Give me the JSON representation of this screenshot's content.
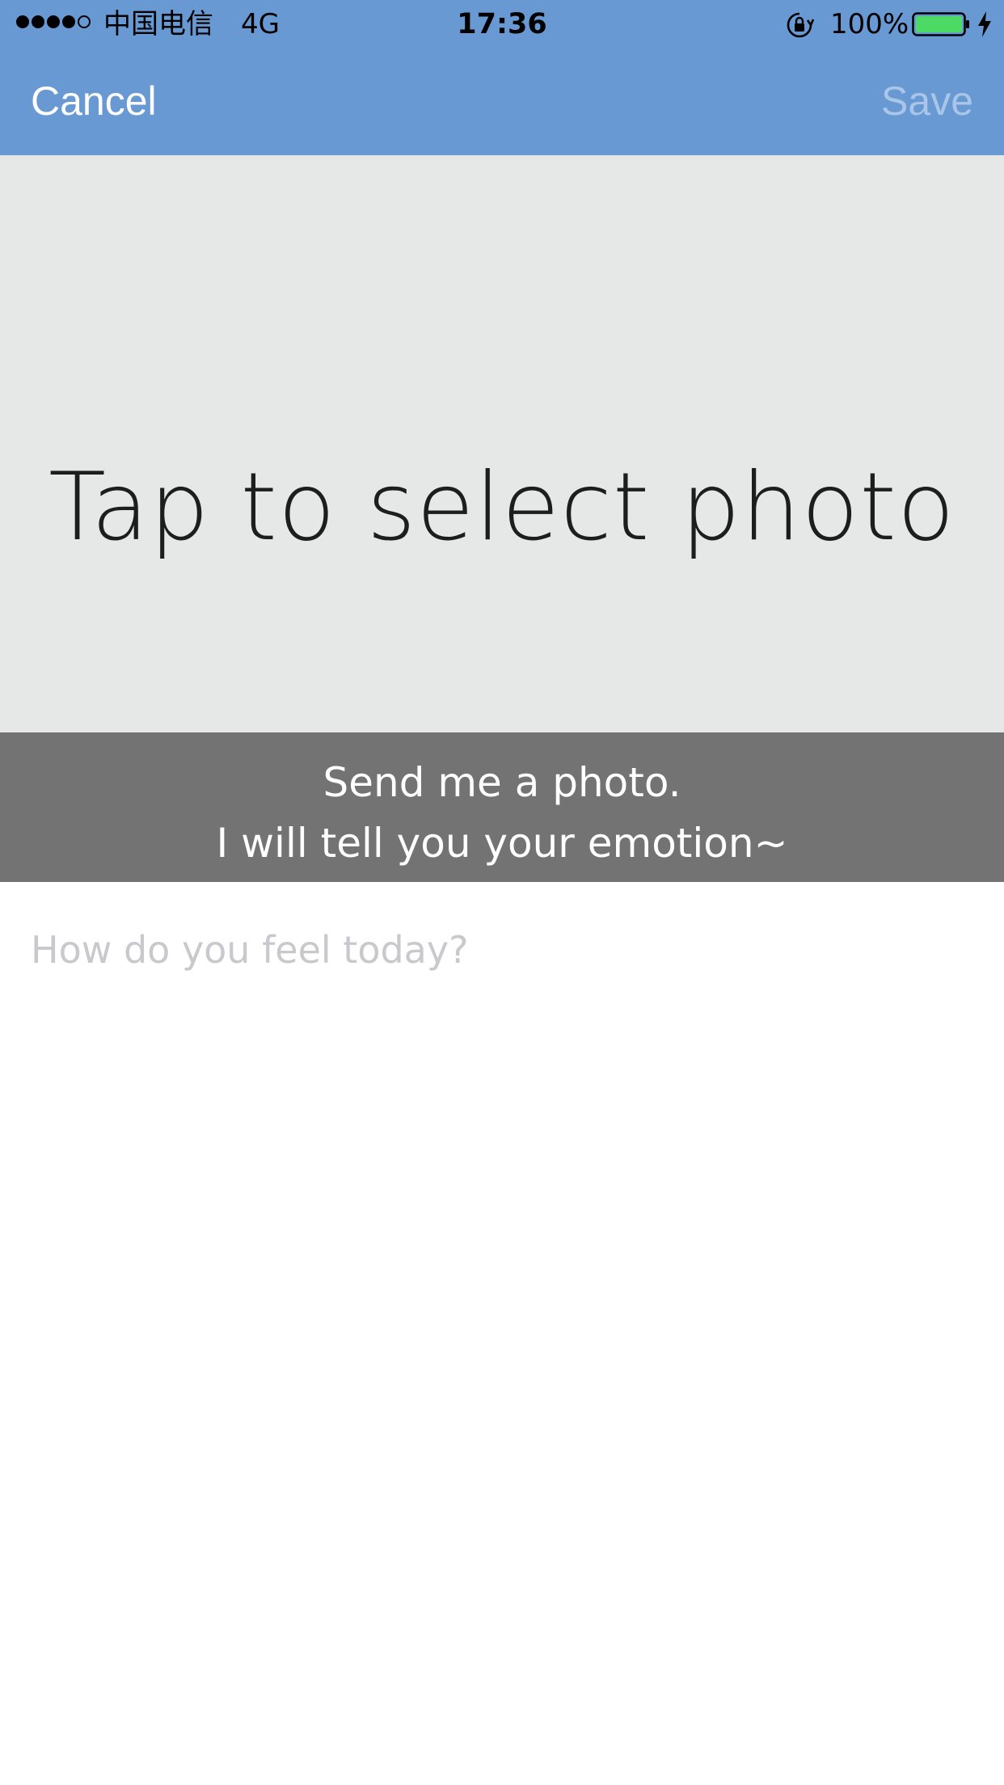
{
  "status_bar": {
    "carrier": "中国电信",
    "network": "4G",
    "time": "17:36",
    "battery_percent": "100%",
    "battery_color": "#4cd964",
    "icons": [
      "signal-dots-icon",
      "rotation-lock-icon",
      "battery-icon",
      "charging-bolt-icon"
    ]
  },
  "nav": {
    "background": "#6899d3",
    "cancel_label": "Cancel",
    "save_label": "Save"
  },
  "photo": {
    "prompt": "Tap to select photo"
  },
  "caption": {
    "line1": "Send me a photo.",
    "line2": "I will tell you your emotion~"
  },
  "entry": {
    "placeholder": "How do you feel today?",
    "value": ""
  }
}
